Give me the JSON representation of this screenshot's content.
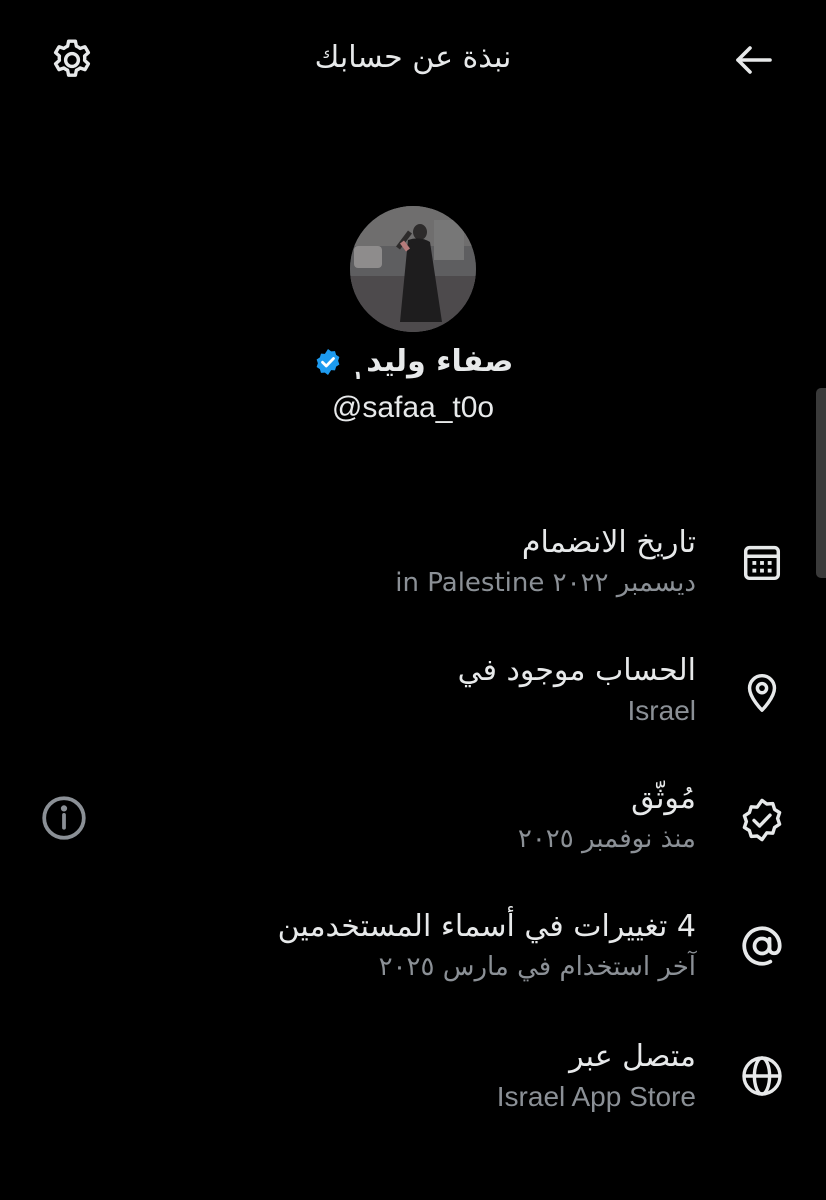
{
  "header": {
    "title": "نبذة عن حسابك",
    "settings_icon": "gear-icon",
    "back_icon": "arrow-left-icon"
  },
  "profile": {
    "display_name": "صفاء وليد ٖ",
    "handle": "@safaa_t0o",
    "verified_color": "#1d9bf0"
  },
  "info": [
    {
      "icon": "calendar-icon",
      "title": "تاريخ الانضمام",
      "subtitle": "ديسمبر ٢٠٢٢ in Palestine"
    },
    {
      "icon": "location-pin-icon",
      "title": "الحساب موجود في",
      "subtitle": "Israel"
    },
    {
      "icon": "verified-badge-icon",
      "title": "مُوثّق",
      "subtitle": "منذ نوفمبر ٢٠٢٥"
    },
    {
      "icon": "at-sign-icon",
      "title": "4 تغييرات في أسماء المستخدمين",
      "subtitle": "آخر استخدام في مارس ٢٠٢٥"
    },
    {
      "icon": "globe-icon",
      "title": "متصل عبر",
      "subtitle": "Israel App Store"
    }
  ],
  "colors": {
    "background": "#000000",
    "text": "#e7e9ea",
    "muted": "#8b9096",
    "verified": "#1d9bf0"
  }
}
